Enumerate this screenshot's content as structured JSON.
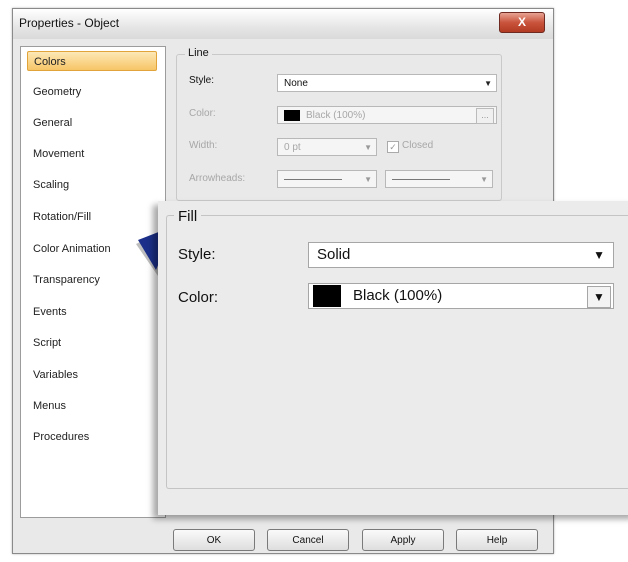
{
  "window": {
    "title": "Properties - Object",
    "close_label": "X"
  },
  "nav": {
    "items": [
      {
        "label": "Colors",
        "selected": true
      },
      {
        "label": "Geometry"
      },
      {
        "label": "General"
      },
      {
        "label": "Movement"
      },
      {
        "label": "Scaling"
      },
      {
        "label": "Rotation/Fill"
      },
      {
        "label": "Color Animation"
      },
      {
        "label": "Transparency"
      },
      {
        "label": "Events"
      },
      {
        "label": "Script"
      },
      {
        "label": "Variables"
      },
      {
        "label": "Menus"
      },
      {
        "label": "Procedures"
      }
    ]
  },
  "line_group": {
    "title": "Line",
    "style_label": "Style:",
    "style_value": "None",
    "color_label": "Color:",
    "color_value": "Black (100%)",
    "color_button": "...",
    "width_label": "Width:",
    "width_value": "0 pt",
    "closed_label": "Closed",
    "closed_checked": true,
    "arrowheads_label": "Arrowheads:"
  },
  "fill_zoom": {
    "title": "Fill",
    "style_label": "Style:",
    "style_value": "Solid",
    "color_label": "Color:",
    "color_value": "Black (100%)",
    "color_swatch": "#000000"
  },
  "buttons": {
    "ok": "OK",
    "cancel": "Cancel",
    "apply": "Apply",
    "help": "Help"
  },
  "colors": {
    "selection": "#f7c567",
    "pointer": "#1b2f8a",
    "close": "#c9543c"
  }
}
